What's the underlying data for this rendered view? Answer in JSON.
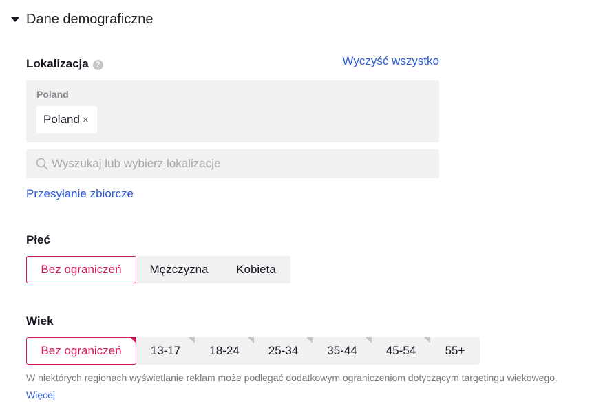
{
  "section": {
    "title": "Dane demograficzne",
    "caret_icon": "caret-down-icon"
  },
  "location": {
    "label": "Lokalizacja",
    "help_icon": "question-circle-icon",
    "help_glyph": "?",
    "clear_all": "Wyczyść wszystko",
    "selected_group_title": "Poland",
    "selected_tags": [
      {
        "label": "Poland",
        "close_glyph": "×"
      }
    ],
    "search_placeholder": "Wyszukaj lub wybierz lokalizacje",
    "search_value": "",
    "bulk_upload": "Przesyłanie zbiorcze"
  },
  "gender": {
    "label": "Płeć",
    "options": [
      "Bez ograniczeń",
      "Mężczyzna",
      "Kobieta"
    ],
    "selected": "Bez ograniczeń"
  },
  "age": {
    "label": "Wiek",
    "options": [
      "Bez ograniczeń",
      "13-17",
      "18-24",
      "25-34",
      "35-44",
      "45-54",
      "55+"
    ],
    "selected": "Bez ograniczeń",
    "note": "W niektórych regionach wyświetlanie reklam może podlegać dodatkowym ograniczeniom dotyczącym targetingu wiekowego.",
    "more_link": "Więcej"
  },
  "colors": {
    "accent": "#d1175a",
    "link": "#2d5bd8",
    "field_bg": "#f1f1f2"
  }
}
